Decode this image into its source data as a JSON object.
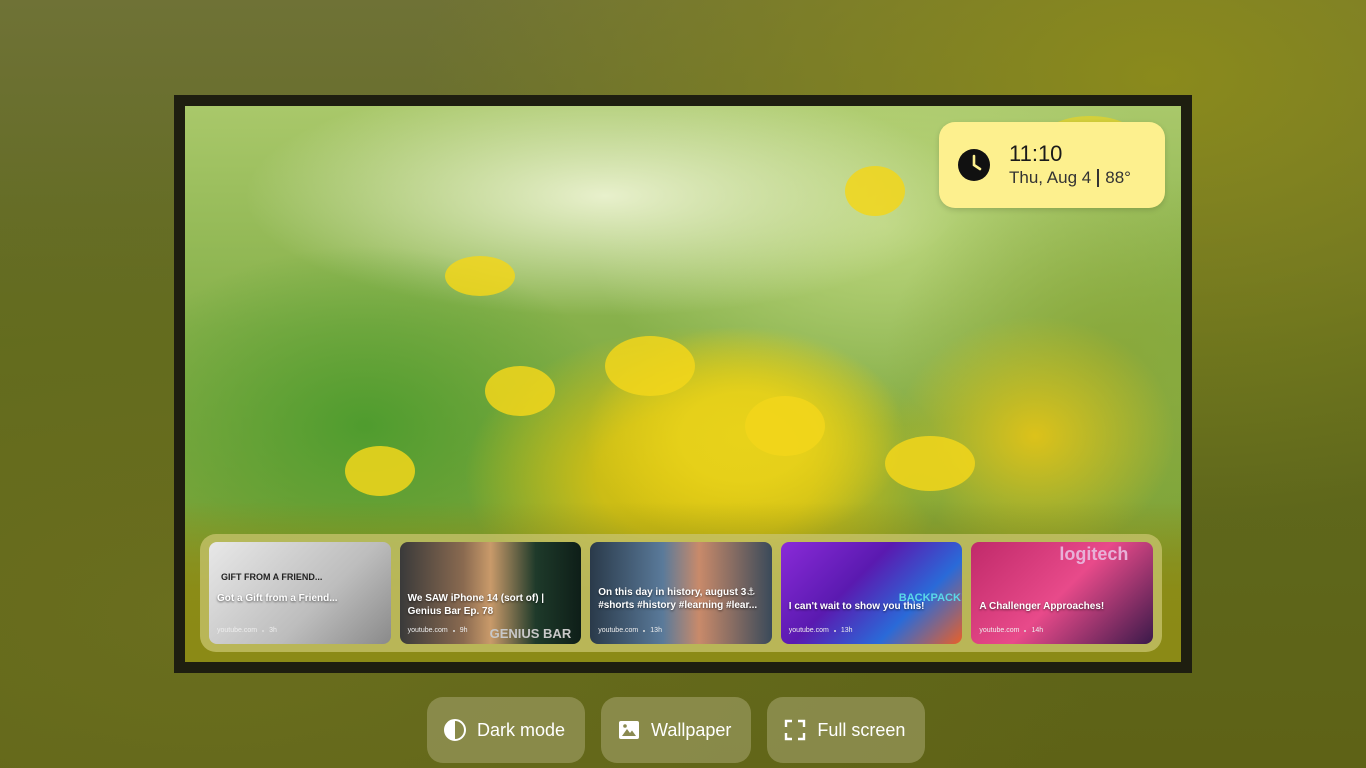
{
  "clock": {
    "time": "11:10",
    "date": "Thu, Aug 4",
    "temperature": "88°",
    "icon": "clock-icon"
  },
  "media": {
    "cards": [
      {
        "title": "Got a Gift from a Friend...",
        "source": "youtube.com",
        "age": "3h",
        "overlay": "GIFT FROM A FRIEND..."
      },
      {
        "title": "We SAW iPhone 14 (sort of) | Genius Bar Ep. 78",
        "source": "youtube.com",
        "age": "9h",
        "overlay": "GENIUS BAR"
      },
      {
        "title": "On this day in history, august 3⚓ #shorts #history #learning #lear...",
        "source": "youtube.com",
        "age": "13h",
        "overlay": ""
      },
      {
        "title": "I can't wait to show you this!",
        "source": "youtube.com",
        "age": "13h",
        "overlay": "BACKPACK!"
      },
      {
        "title": "A Challenger Approaches!",
        "source": "youtube.com",
        "age": "14h",
        "overlay": "logitech"
      }
    ]
  },
  "toolbar": {
    "dark_mode": {
      "label": "Dark mode",
      "icon": "contrast-icon"
    },
    "wallpaper": {
      "label": "Wallpaper",
      "icon": "image-icon"
    },
    "full_screen": {
      "label": "Full screen",
      "icon": "fullscreen-icon"
    }
  },
  "colors": {
    "widget_bg": "#fdf08e",
    "frame": "#1e1e10",
    "strip_bg": "#c8c46e"
  }
}
